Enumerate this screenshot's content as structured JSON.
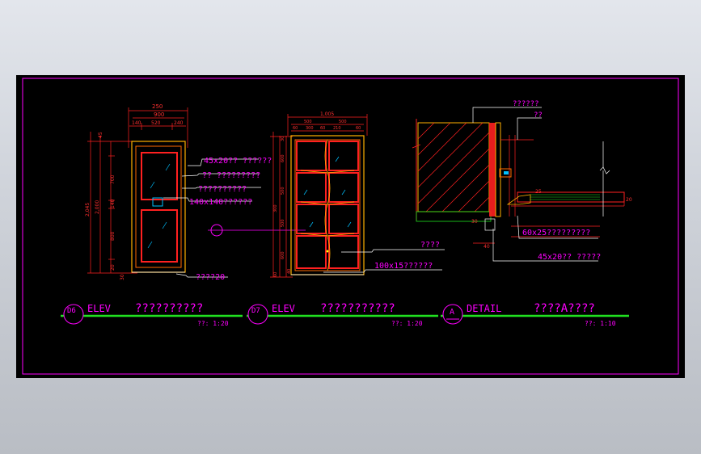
{
  "colors": {
    "background": "#000000",
    "frame": "#ff00ff",
    "dimension": "#ff2020",
    "outline": "#ff6a00",
    "door": "#ffb000",
    "leader": "#ffffff",
    "title_line": "#20e020",
    "glass_hatch": "#00c0ff"
  },
  "drawings": {
    "d6": {
      "tag": "D6",
      "view": "ELEV",
      "name": "??????????",
      "scale": "??: 1:20",
      "dims_top": [
        "250",
        "900",
        "140",
        "520",
        "240"
      ],
      "dims_left": [
        "45",
        "2,045",
        "2,000",
        "140",
        "700",
        "800",
        "20",
        "30"
      ],
      "notes": [
        "45x20?? ??????",
        "?? ?????????",
        "??????????",
        "140x140??????",
        "????20"
      ]
    },
    "d7": {
      "tag": "D7",
      "view": "ELEV",
      "name": "???????????",
      "scale": "??: 1:20",
      "dims_top": [
        "1,005",
        "500",
        "500",
        "60",
        "300",
        "60",
        "210",
        "60"
      ],
      "dims_left": [
        "30",
        "600",
        "500",
        "500",
        "600",
        "300",
        "40",
        "60"
      ],
      "notes": [
        "????",
        "100x15??????"
      ]
    },
    "detail_a": {
      "tag": "A",
      "view": "DETAIL",
      "name": "????A????",
      "scale": "??: 1:10",
      "notes": [
        "??????",
        "??",
        "60x25?????????",
        "45x20?? ?????"
      ],
      "dims": [
        "20",
        "25",
        "40",
        "30"
      ]
    }
  }
}
